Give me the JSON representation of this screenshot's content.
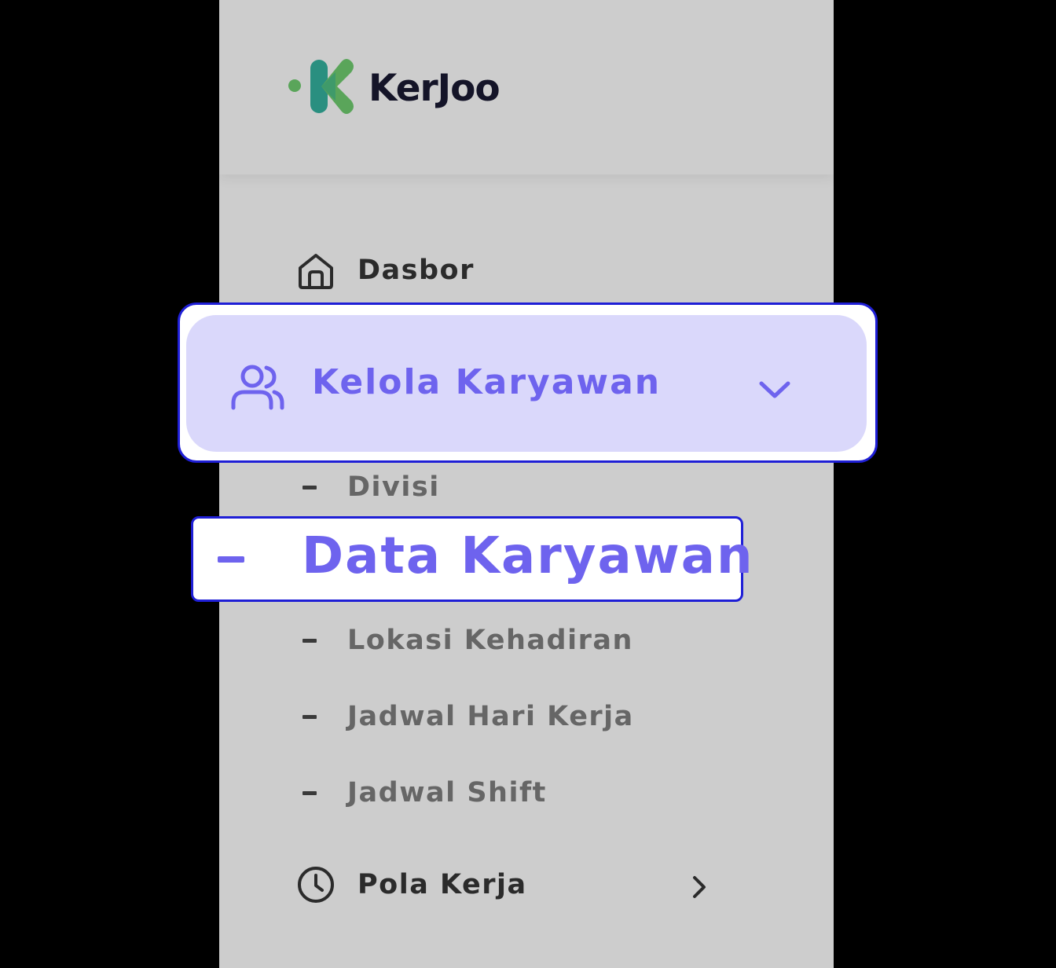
{
  "brand": {
    "name": "KerJoo",
    "colors": {
      "logo_green": "#5aa55a",
      "logo_teal": "#2a8f80",
      "accent": "#6e63ee",
      "highlight_bg": "#dad8fb",
      "outline": "#1f1fd6"
    }
  },
  "sidebar": {
    "items": [
      {
        "label": "Dasbor",
        "icon": "home-icon"
      },
      {
        "label": "Kelola Karyawan",
        "icon": "users-icon",
        "expanded": true,
        "chevron": "chevron-down-icon"
      },
      {
        "label": "Pola Kerja",
        "icon": "clock-icon",
        "chevron": "chevron-right-icon"
      }
    ],
    "submenu": [
      {
        "label": "Divisi"
      },
      {
        "label": "Data Karyawan",
        "active": true
      },
      {
        "label": "Lokasi Kehadiran"
      },
      {
        "label": "Jadwal Hari Kerja"
      },
      {
        "label": "Jadwal Shift"
      }
    ]
  }
}
